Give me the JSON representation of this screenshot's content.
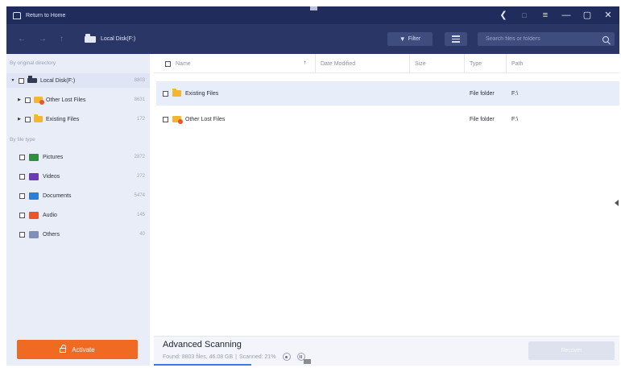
{
  "titlebar": {
    "home_label": "Return to Home",
    "controls": [
      "share-icon",
      "feedback-icon",
      "menu-icon",
      "minimize-icon",
      "maximize-icon",
      "close-icon"
    ]
  },
  "toolbar": {
    "breadcrumb": "Local Disk(F:)",
    "filter_label": "Filter",
    "search_placeholder": "Search files or folders"
  },
  "sidebar": {
    "section_directory": "By original directory",
    "directory_items": [
      {
        "label": "Local Disk(F:)",
        "count": "8803"
      },
      {
        "label": "Other Lost Files",
        "count": "8631"
      },
      {
        "label": "Existing Files",
        "count": "172"
      }
    ],
    "section_type": "By file type",
    "type_items": [
      {
        "label": "Pictures",
        "count": "2872"
      },
      {
        "label": "Videos",
        "count": "272"
      },
      {
        "label": "Documents",
        "count": "5474"
      },
      {
        "label": "Audio",
        "count": "145"
      },
      {
        "label": "Others",
        "count": "40"
      }
    ],
    "activate_label": "Activate"
  },
  "table": {
    "columns": [
      "Name",
      "Date Modified",
      "Size",
      "Type",
      "Path"
    ],
    "rows": [
      {
        "name": "Existing Files",
        "date": "",
        "size": "",
        "type": "File folder",
        "path": "F:\\"
      },
      {
        "name": "Other Lost Files",
        "date": "",
        "size": "",
        "type": "File folder",
        "path": "F:\\"
      }
    ]
  },
  "status": {
    "title": "Advanced Scanning",
    "found": "Found: 8803 files, 46.08 GB",
    "separator": "|",
    "scanned": "Scanned: 21%",
    "progress": 0.21,
    "recover_label": "Recover"
  },
  "colors": {
    "titlebar": "#1f2c5c",
    "toolbar": "#2a3766",
    "sidebar": "#e9edf7",
    "accent": "#f16a22",
    "selected_row": "#e8eef9"
  }
}
